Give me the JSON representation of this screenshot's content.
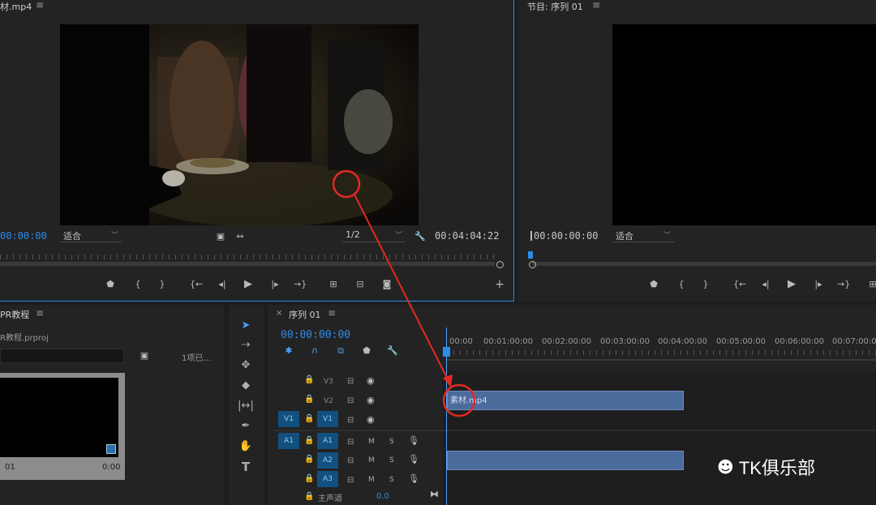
{
  "source_monitor": {
    "tab_title": "材.mp4",
    "timecode_in": "00:00:00",
    "fit_label": "适合",
    "resolution_label": "1/2",
    "timecode_out": "00:04:04:22"
  },
  "program_monitor": {
    "tab_title": "节目: 序列 01",
    "timecode": "00:00:00:00",
    "fit_label": "适合"
  },
  "project_panel": {
    "tab_title": "PR教程",
    "file_name": "R教程.prproj",
    "item_count": "1项已...",
    "thumb_label": "01",
    "thumb_duration": "0:00"
  },
  "timeline": {
    "tab_title": "序列 01",
    "timecode": "00:00:00:00",
    "ruler_labels": [
      "00:00",
      "00:01:00:00",
      "00:02:00:00",
      "00:03:00:00",
      "00:04:00:00",
      "00:05:00:00",
      "00:06:00:00",
      "00:07:00:00"
    ],
    "video_tracks": [
      "V3",
      "V2",
      "V1"
    ],
    "audio_tracks": [
      "A1",
      "A2",
      "A3"
    ],
    "source_v": "V1",
    "source_a": "A1",
    "mute_label": "M",
    "solo_label": "S",
    "master_label": "主声道",
    "master_value": "0.0",
    "clip_name": "素材.mp4"
  },
  "watermark": {
    "text": "TK俱乐部"
  },
  "colors": {
    "accent_blue": "#2d8ceb",
    "clip_blue": "#4b6b9c",
    "annotation_red": "#e02a24"
  }
}
